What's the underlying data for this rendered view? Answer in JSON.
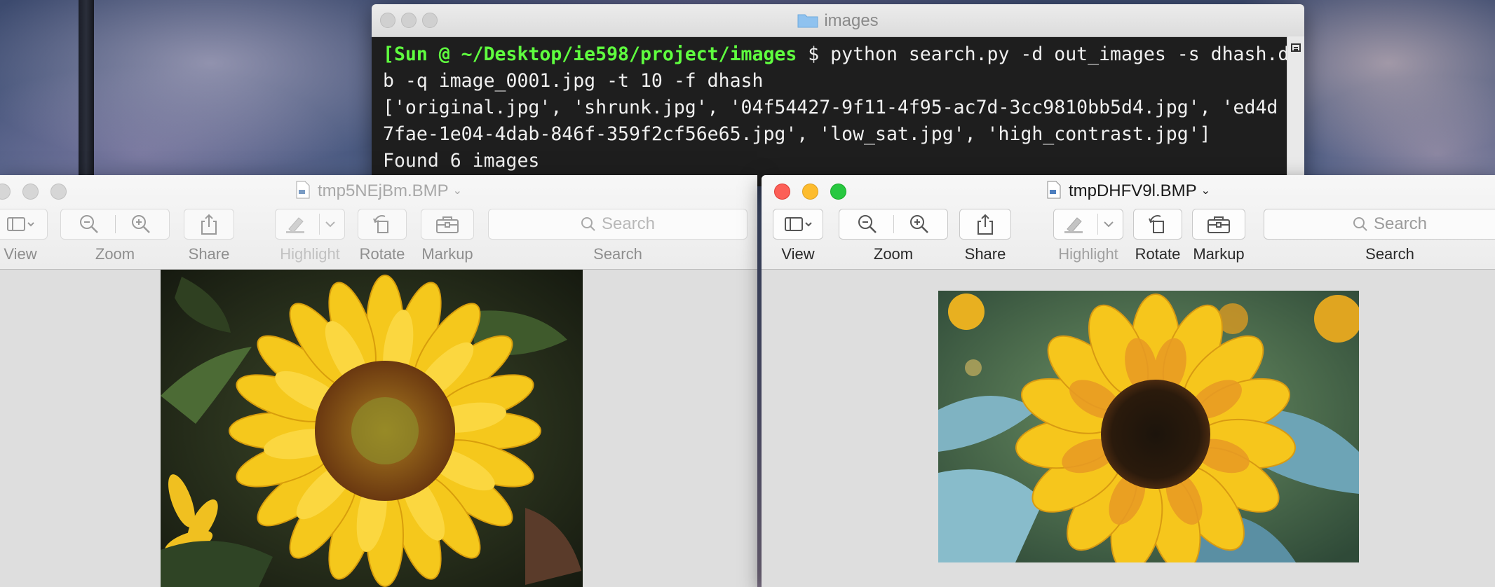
{
  "terminal": {
    "title": "images",
    "prompt": "[Sun @ ~/Desktop/ie598/project/images",
    "command_line1": " $ python search.py -d out_images -s dhash.d]",
    "command_line2": "b -q image_0001.jpg -t 10 -f dhash",
    "output_line1": "['original.jpg', 'shrunk.jpg', '04f54427-9f11-4f95-ac7d-3cc9810bb5d4.jpg', 'ed4d",
    "output_line2": "7fae-1e04-4dab-846f-359f2cf56e65.jpg', 'low_sat.jpg', 'high_contrast.jpg']",
    "output_line3": "Found 6 images"
  },
  "preview_left": {
    "title": "tmp5NEjBm.BMP",
    "toolbar": {
      "view": "View",
      "zoom": "Zoom",
      "share": "Share",
      "highlight": "Highlight",
      "rotate": "Rotate",
      "markup": "Markup",
      "search_placeholder": "Search",
      "search_label": "Search"
    },
    "image_icon": "sunflower-photo"
  },
  "preview_right": {
    "title": "tmpDHFV9l.BMP",
    "toolbar": {
      "view": "View",
      "zoom": "Zoom",
      "share": "Share",
      "highlight": "Highlight",
      "rotate": "Rotate",
      "markup": "Markup",
      "search_placeholder": "Search",
      "search_label": "Search"
    },
    "image_icon": "sunflower-photo-high-contrast"
  },
  "colors": {
    "prompt_green": "#5fff3f",
    "terminal_bg": "#1e1e1e",
    "traffic_red": "#fc5f57",
    "traffic_yellow": "#fdbc2e",
    "traffic_green": "#28c840"
  }
}
